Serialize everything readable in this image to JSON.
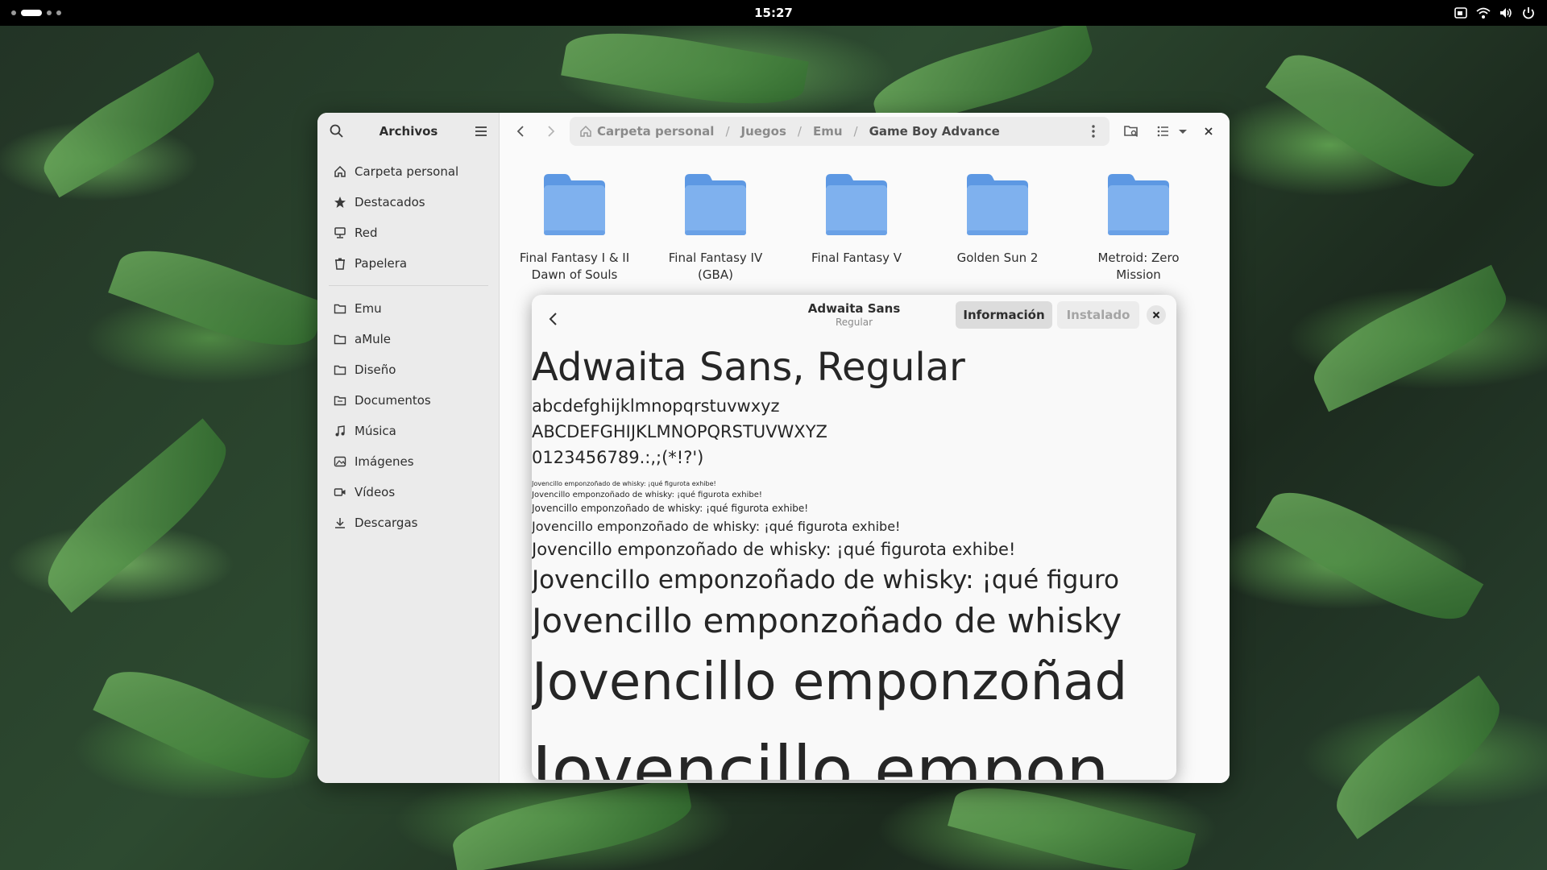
{
  "topbar": {
    "clock": "15:27",
    "icons": [
      "screen-share-icon",
      "wifi-icon",
      "volume-icon",
      "power-icon"
    ]
  },
  "sidebar": {
    "title": "Archivos",
    "places": [
      {
        "label": "Carpeta personal",
        "icon": "home-icon"
      },
      {
        "label": "Destacados",
        "icon": "star-icon"
      },
      {
        "label": "Red",
        "icon": "network-icon"
      },
      {
        "label": "Papelera",
        "icon": "trash-icon"
      }
    ],
    "bookmarks": [
      {
        "label": "Emu",
        "icon": "folder-icon"
      },
      {
        "label": "aMule",
        "icon": "folder-icon"
      },
      {
        "label": "Diseño",
        "icon": "folder-icon"
      },
      {
        "label": "Documentos",
        "icon": "document-icon"
      },
      {
        "label": "Música",
        "icon": "music-icon"
      },
      {
        "label": "Imágenes",
        "icon": "image-icon"
      },
      {
        "label": "Vídeos",
        "icon": "video-icon"
      },
      {
        "label": "Descargas",
        "icon": "download-icon"
      }
    ]
  },
  "pathbar": {
    "crumbs": [
      "Carpeta personal",
      "Juegos",
      "Emu",
      "Game Boy Advance"
    ],
    "separator": "/"
  },
  "folders": [
    {
      "line1": "Final Fantasy I & II",
      "line2": "Dawn of Souls"
    },
    {
      "line1": "Final Fantasy IV",
      "line2": "(GBA)"
    },
    {
      "line1": "Final Fantasy V",
      "line2": ""
    },
    {
      "line1": "Golden Sun 2",
      "line2": ""
    },
    {
      "line1": "Metroid: Zero",
      "line2": "Mission"
    }
  ],
  "colors": {
    "folder_body": "#7fb1ee",
    "folder_tab": "#5d98e3",
    "window_bg": "#fafafa",
    "sidebar_bg": "#ebebeb"
  },
  "font_viewer": {
    "title": "Adwaita Sans",
    "subtitle": "Regular",
    "tab_info": "Información",
    "tab_installed": "Instalado",
    "heading": "Adwaita Sans, Regular",
    "lowercase": "abcdefghijklmnopqrstuvwxyz",
    "uppercase": "ABCDEFGHIJKLMNOPQRSTUVWXYZ",
    "digits": "0123456789.:,;(*!?')",
    "pangram": "Jovencillo emponzoñado de whisky: ¡qué figurota exhibe!",
    "pangram_clip_6": "Jovencillo emponzoñado de whisky: ¡qué figuro",
    "pangram_clip_7": "Jovencillo emponzoñado de whisky",
    "pangram_clip_8": "Jovencillo emponzoñad",
    "pangram_clip_9": "Jovencillo empon"
  }
}
